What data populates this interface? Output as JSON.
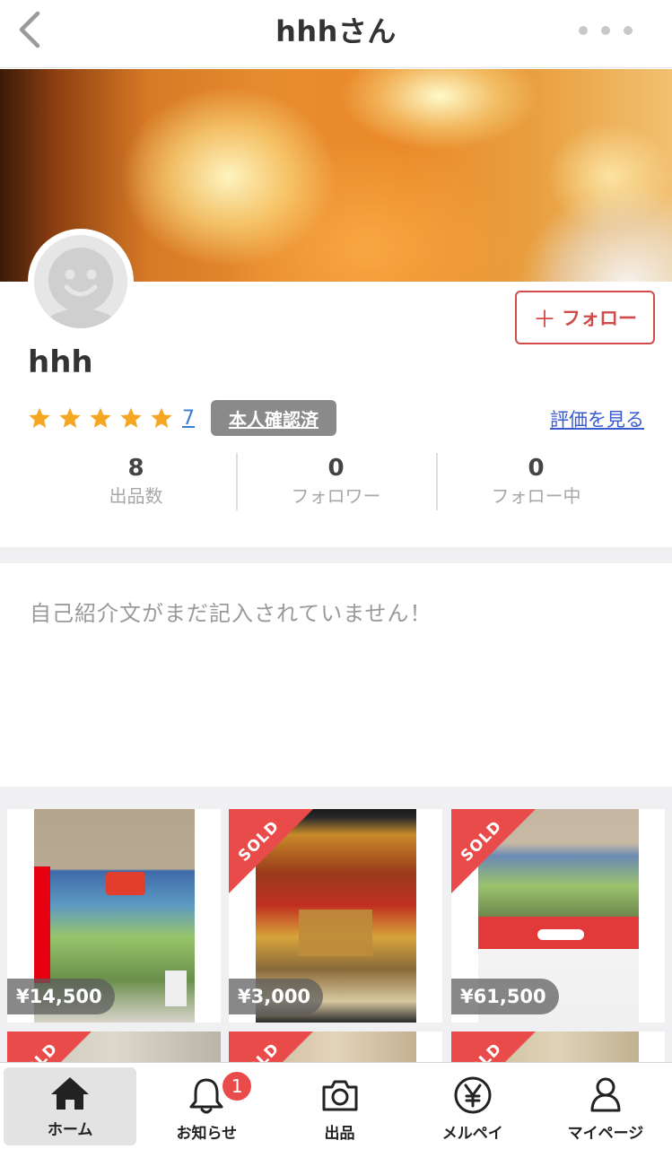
{
  "header": {
    "title": "hhhさん"
  },
  "profile": {
    "username": "hhh",
    "follow_label": "フォロー",
    "rating_count": "7",
    "verified_label": "本人確認済",
    "see_reviews_label": "評価を見る",
    "stars": 5,
    "stats": [
      {
        "value": "8",
        "label": "出品数"
      },
      {
        "value": "0",
        "label": "フォロワー"
      },
      {
        "value": "0",
        "label": "フォロー中"
      }
    ],
    "bio": "自己紹介文がまだ記入されていません！"
  },
  "items": [
    {
      "price": "¥14,500",
      "sold": false
    },
    {
      "price": "¥3,000",
      "sold": true,
      "sold_label": "SOLD"
    },
    {
      "price": "¥61,500",
      "sold": true,
      "sold_label": "SOLD"
    },
    {
      "sold": true,
      "sold_label": "SOLD"
    },
    {
      "sold": true,
      "sold_label": "SOLD"
    },
    {
      "sold": true,
      "sold_label": "SOLD"
    }
  ],
  "tabbar": {
    "tabs": [
      {
        "label": "ホーム",
        "icon": "home-icon",
        "active": true
      },
      {
        "label": "お知らせ",
        "icon": "bell-icon",
        "badge": "1"
      },
      {
        "label": "出品",
        "icon": "camera-icon"
      },
      {
        "label": "メルペイ",
        "icon": "yen-icon"
      },
      {
        "label": "マイページ",
        "icon": "person-icon"
      }
    ]
  },
  "colors": {
    "accent": "#d24a4a",
    "sold": "#e94b4b",
    "link": "#3a5bd0",
    "star": "#f5a623"
  }
}
